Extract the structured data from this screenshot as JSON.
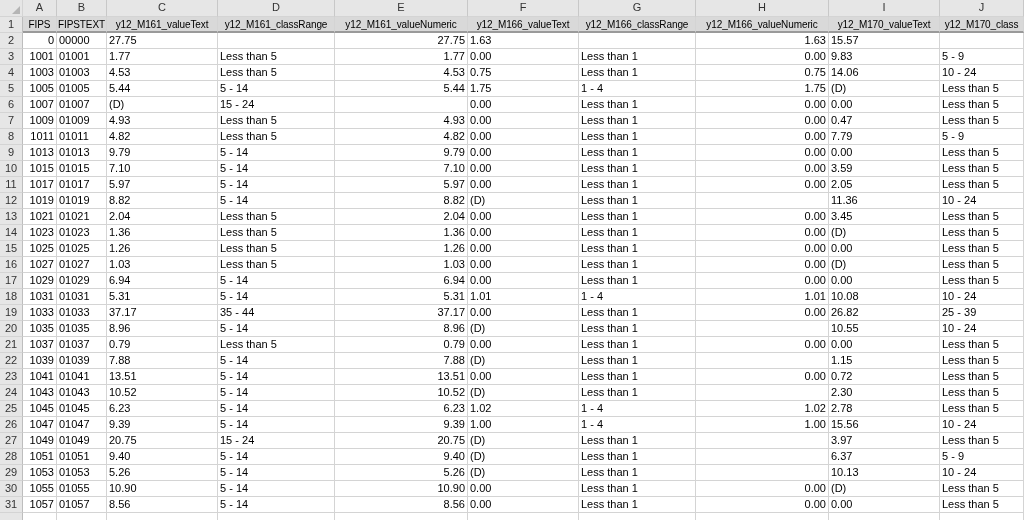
{
  "column_letters": [
    "A",
    "B",
    "C",
    "D",
    "E",
    "F",
    "G",
    "H",
    "I",
    "J"
  ],
  "header_row": {
    "number": "1",
    "cells": [
      "FIPS",
      "FIPSTEXT",
      "y12_M161_valueText",
      "y12_M161_classRange",
      "y12_M161_valueNumeric",
      "y12_M166_valueText",
      "y12_M166_classRange",
      "y12_M166_valueNumeric",
      "y12_M170_valueText",
      "y12_M170_class"
    ]
  },
  "rows": [
    {
      "number": "2",
      "cells": [
        "0",
        "00000",
        "27.75",
        null,
        "27.75",
        "1.63",
        null,
        "1.63",
        "15.57",
        null
      ]
    },
    {
      "number": "3",
      "cells": [
        "1001",
        "01001",
        "1.77",
        "Less than 5",
        "1.77",
        "0.00",
        "Less than 1",
        "0.00",
        "9.83",
        "5 - 9"
      ]
    },
    {
      "number": "4",
      "cells": [
        "1003",
        "01003",
        "4.53",
        "Less than 5",
        "4.53",
        "0.75",
        "Less than 1",
        "0.75",
        "14.06",
        "10 - 24"
      ]
    },
    {
      "number": "5",
      "cells": [
        "1005",
        "01005",
        "5.44",
        "5 - 14",
        "5.44",
        "1.75",
        "1 - 4",
        "1.75",
        "(D)",
        "Less than 5"
      ]
    },
    {
      "number": "6",
      "cells": [
        "1007",
        "01007",
        "(D)",
        "15 - 24",
        null,
        "0.00",
        "Less than 1",
        "0.00",
        "0.00",
        "Less than 5"
      ]
    },
    {
      "number": "7",
      "cells": [
        "1009",
        "01009",
        "4.93",
        "Less than 5",
        "4.93",
        "0.00",
        "Less than 1",
        "0.00",
        "0.47",
        "Less than 5"
      ]
    },
    {
      "number": "8",
      "cells": [
        "1011",
        "01011",
        "4.82",
        "Less than 5",
        "4.82",
        "0.00",
        "Less than 1",
        "0.00",
        "7.79",
        "5 - 9"
      ]
    },
    {
      "number": "9",
      "cells": [
        "1013",
        "01013",
        "9.79",
        "5 - 14",
        "9.79",
        "0.00",
        "Less than 1",
        "0.00",
        "0.00",
        "Less than 5"
      ]
    },
    {
      "number": "10",
      "cells": [
        "1015",
        "01015",
        "7.10",
        "5 - 14",
        "7.10",
        "0.00",
        "Less than 1",
        "0.00",
        "3.59",
        "Less than 5"
      ]
    },
    {
      "number": "11",
      "cells": [
        "1017",
        "01017",
        "5.97",
        "5 - 14",
        "5.97",
        "0.00",
        "Less than 1",
        "0.00",
        "2.05",
        "Less than 5"
      ]
    },
    {
      "number": "12",
      "cells": [
        "1019",
        "01019",
        "8.82",
        "5 - 14",
        "8.82",
        "(D)",
        "Less than 1",
        null,
        "11.36",
        "10 - 24"
      ]
    },
    {
      "number": "13",
      "cells": [
        "1021",
        "01021",
        "2.04",
        "Less than 5",
        "2.04",
        "0.00",
        "Less than 1",
        "0.00",
        "3.45",
        "Less than 5"
      ]
    },
    {
      "number": "14",
      "cells": [
        "1023",
        "01023",
        "1.36",
        "Less than 5",
        "1.36",
        "0.00",
        "Less than 1",
        "0.00",
        "(D)",
        "Less than 5"
      ]
    },
    {
      "number": "15",
      "cells": [
        "1025",
        "01025",
        "1.26",
        "Less than 5",
        "1.26",
        "0.00",
        "Less than 1",
        "0.00",
        "0.00",
        "Less than 5"
      ]
    },
    {
      "number": "16",
      "cells": [
        "1027",
        "01027",
        "1.03",
        "Less than 5",
        "1.03",
        "0.00",
        "Less than 1",
        "0.00",
        "(D)",
        "Less than 5"
      ]
    },
    {
      "number": "17",
      "cells": [
        "1029",
        "01029",
        "6.94",
        "5 - 14",
        "6.94",
        "0.00",
        "Less than 1",
        "0.00",
        "0.00",
        "Less than 5"
      ]
    },
    {
      "number": "18",
      "cells": [
        "1031",
        "01031",
        "5.31",
        "5 - 14",
        "5.31",
        "1.01",
        "1 - 4",
        "1.01",
        "10.08",
        "10 - 24"
      ]
    },
    {
      "number": "19",
      "cells": [
        "1033",
        "01033",
        "37.17",
        "35 - 44",
        "37.17",
        "0.00",
        "Less than 1",
        "0.00",
        "26.82",
        "25 - 39"
      ]
    },
    {
      "number": "20",
      "cells": [
        "1035",
        "01035",
        "8.96",
        "5 - 14",
        "8.96",
        "(D)",
        "Less than 1",
        null,
        "10.55",
        "10 - 24"
      ]
    },
    {
      "number": "21",
      "cells": [
        "1037",
        "01037",
        "0.79",
        "Less than 5",
        "0.79",
        "0.00",
        "Less than 1",
        "0.00",
        "0.00",
        "Less than 5"
      ]
    },
    {
      "number": "22",
      "cells": [
        "1039",
        "01039",
        "7.88",
        "5 - 14",
        "7.88",
        "(D)",
        "Less than 1",
        null,
        "1.15",
        "Less than 5"
      ]
    },
    {
      "number": "23",
      "cells": [
        "1041",
        "01041",
        "13.51",
        "5 - 14",
        "13.51",
        "0.00",
        "Less than 1",
        "0.00",
        "0.72",
        "Less than 5"
      ]
    },
    {
      "number": "24",
      "cells": [
        "1043",
        "01043",
        "10.52",
        "5 - 14",
        "10.52",
        "(D)",
        "Less than 1",
        null,
        "2.30",
        "Less than 5"
      ]
    },
    {
      "number": "25",
      "cells": [
        "1045",
        "01045",
        "6.23",
        "5 - 14",
        "6.23",
        "1.02",
        "1 - 4",
        "1.02",
        "2.78",
        "Less than 5"
      ]
    },
    {
      "number": "26",
      "cells": [
        "1047",
        "01047",
        "9.39",
        "5 - 14",
        "9.39",
        "1.00",
        "1 - 4",
        "1.00",
        "15.56",
        "10 - 24"
      ]
    },
    {
      "number": "27",
      "cells": [
        "1049",
        "01049",
        "20.75",
        "15 - 24",
        "20.75",
        "(D)",
        "Less than 1",
        null,
        "3.97",
        "Less than 5"
      ]
    },
    {
      "number": "28",
      "cells": [
        "1051",
        "01051",
        "9.40",
        "5 - 14",
        "9.40",
        "(D)",
        "Less than 1",
        null,
        "6.37",
        "5 - 9"
      ]
    },
    {
      "number": "29",
      "cells": [
        "1053",
        "01053",
        "5.26",
        "5 - 14",
        "5.26",
        "(D)",
        "Less than 1",
        null,
        "10.13",
        "10 - 24"
      ]
    },
    {
      "number": "30",
      "cells": [
        "1055",
        "01055",
        "10.90",
        "5 - 14",
        "10.90",
        "0.00",
        "Less than 1",
        "0.00",
        "(D)",
        "Less than 5"
      ]
    },
    {
      "number": "31",
      "cells": [
        "1057",
        "01057",
        "8.56",
        "5 - 14",
        "8.56",
        "0.00",
        "Less than 1",
        "0.00",
        "0.00",
        "Less than 5"
      ]
    }
  ]
}
